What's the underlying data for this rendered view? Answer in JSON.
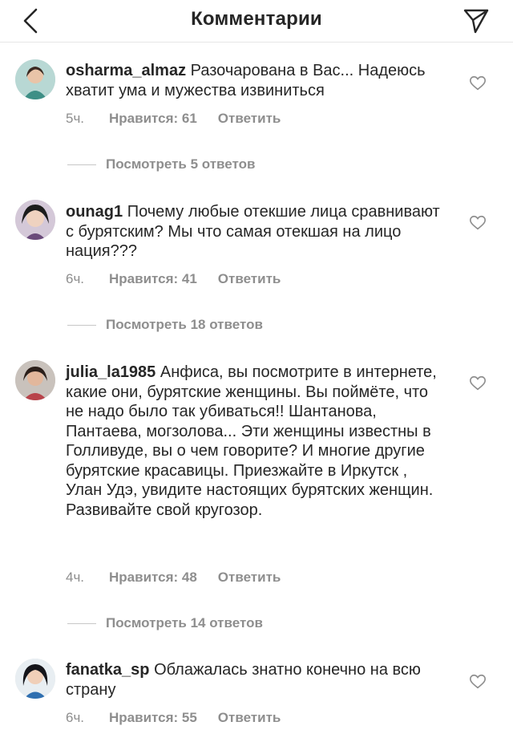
{
  "header": {
    "title": "Комментарии"
  },
  "comments": [
    {
      "username": "osharma_almaz",
      "text": "Разочарована в Вас... Надеюсь хватит ума и мужества извиниться",
      "time": "5ч.",
      "likes": "Нравится: 61",
      "reply_label": "Ответить",
      "view_replies": "Посмотреть 5 ответов"
    },
    {
      "username": "ounag1",
      "text": "Почему любые отекшие лица сравнивают с бурятским? Мы что самая отекшая на лицо нация???",
      "time": "6ч.",
      "likes": "Нравится: 41",
      "reply_label": "Ответить",
      "view_replies": "Посмотреть 18 ответов"
    },
    {
      "username": "julia_la1985",
      "text": "Анфиса, вы посмотрите в интернете, какие они, бурятские женщины. Вы поймёте, что не надо было так убиваться!! Шантанова, Пантаева, могзолова... Эти женщины известны в Голливуде, вы о чем говорите? И многие другие бурятские красавицы. Приезжайте в Иркутск , Улан Удэ, увидите настоящих бурятских женщин. Развивайте свой кругозор.",
      "time": "4ч.",
      "likes": "Нравится: 48",
      "reply_label": "Ответить",
      "view_replies": "Посмотреть 14 ответов"
    },
    {
      "username": "fanatka_sp",
      "text": "Облажалась знатно конечно на всю страну",
      "time": "6ч.",
      "likes": "Нравится: 55",
      "reply_label": "Ответить"
    }
  ]
}
